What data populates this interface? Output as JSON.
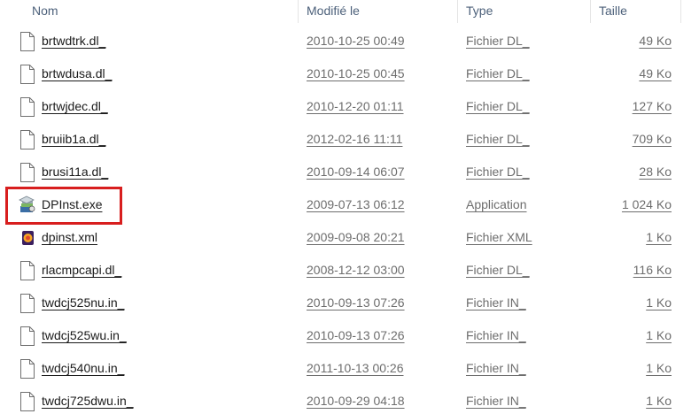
{
  "columns": {
    "name": "Nom",
    "modified": "Modifié le",
    "type": "Type",
    "size": "Taille"
  },
  "files": [
    {
      "name": "brtwdtrk.dl_",
      "modified": "2010-10-25 00:49",
      "type": "Fichier DL_",
      "size": "49 Ko",
      "icon": "file-icon"
    },
    {
      "name": "brtwdusa.dl_",
      "modified": "2010-10-25 00:45",
      "type": "Fichier DL_",
      "size": "49 Ko",
      "icon": "file-icon"
    },
    {
      "name": "brtwjdec.dl_",
      "modified": "2010-12-20 01:11",
      "type": "Fichier DL_",
      "size": "127 Ko",
      "icon": "file-icon"
    },
    {
      "name": "bruiib1a.dl_",
      "modified": "2012-02-16 11:11",
      "type": "Fichier DL_",
      "size": "709 Ko",
      "icon": "file-icon"
    },
    {
      "name": "brusi11a.dl_",
      "modified": "2010-09-14 06:07",
      "type": "Fichier DL_",
      "size": "28 Ko",
      "icon": "file-icon"
    },
    {
      "name": "DPInst.exe",
      "modified": "2009-07-13 06:12",
      "type": "Application",
      "size": "1 024 Ko",
      "icon": "installer-icon"
    },
    {
      "name": "dpinst.xml",
      "modified": "2009-09-08 20:21",
      "type": "Fichier XML",
      "size": "1 Ko",
      "icon": "xml-file-icon"
    },
    {
      "name": "rlacmpcapi.dl_",
      "modified": "2008-12-12 03:00",
      "type": "Fichier DL_",
      "size": "116 Ko",
      "icon": "file-icon"
    },
    {
      "name": "twdcj525nu.in_",
      "modified": "2010-09-13 07:26",
      "type": "Fichier IN_",
      "size": "1 Ko",
      "icon": "file-icon"
    },
    {
      "name": "twdcj525wu.in_",
      "modified": "2010-09-13 07:26",
      "type": "Fichier IN_",
      "size": "1 Ko",
      "icon": "file-icon"
    },
    {
      "name": "twdcj540nu.in_",
      "modified": "2011-10-13 00:26",
      "type": "Fichier IN_",
      "size": "1 Ko",
      "icon": "file-icon"
    },
    {
      "name": "twdcj725dwu.in_",
      "modified": "2010-09-29 04:18",
      "type": "Fichier IN_",
      "size": "1 Ko",
      "icon": "file-icon"
    }
  ],
  "colors": {
    "header_text": "#4c607a",
    "highlight_border": "#d81e1e",
    "secondary_text": "#6d6d6d"
  }
}
